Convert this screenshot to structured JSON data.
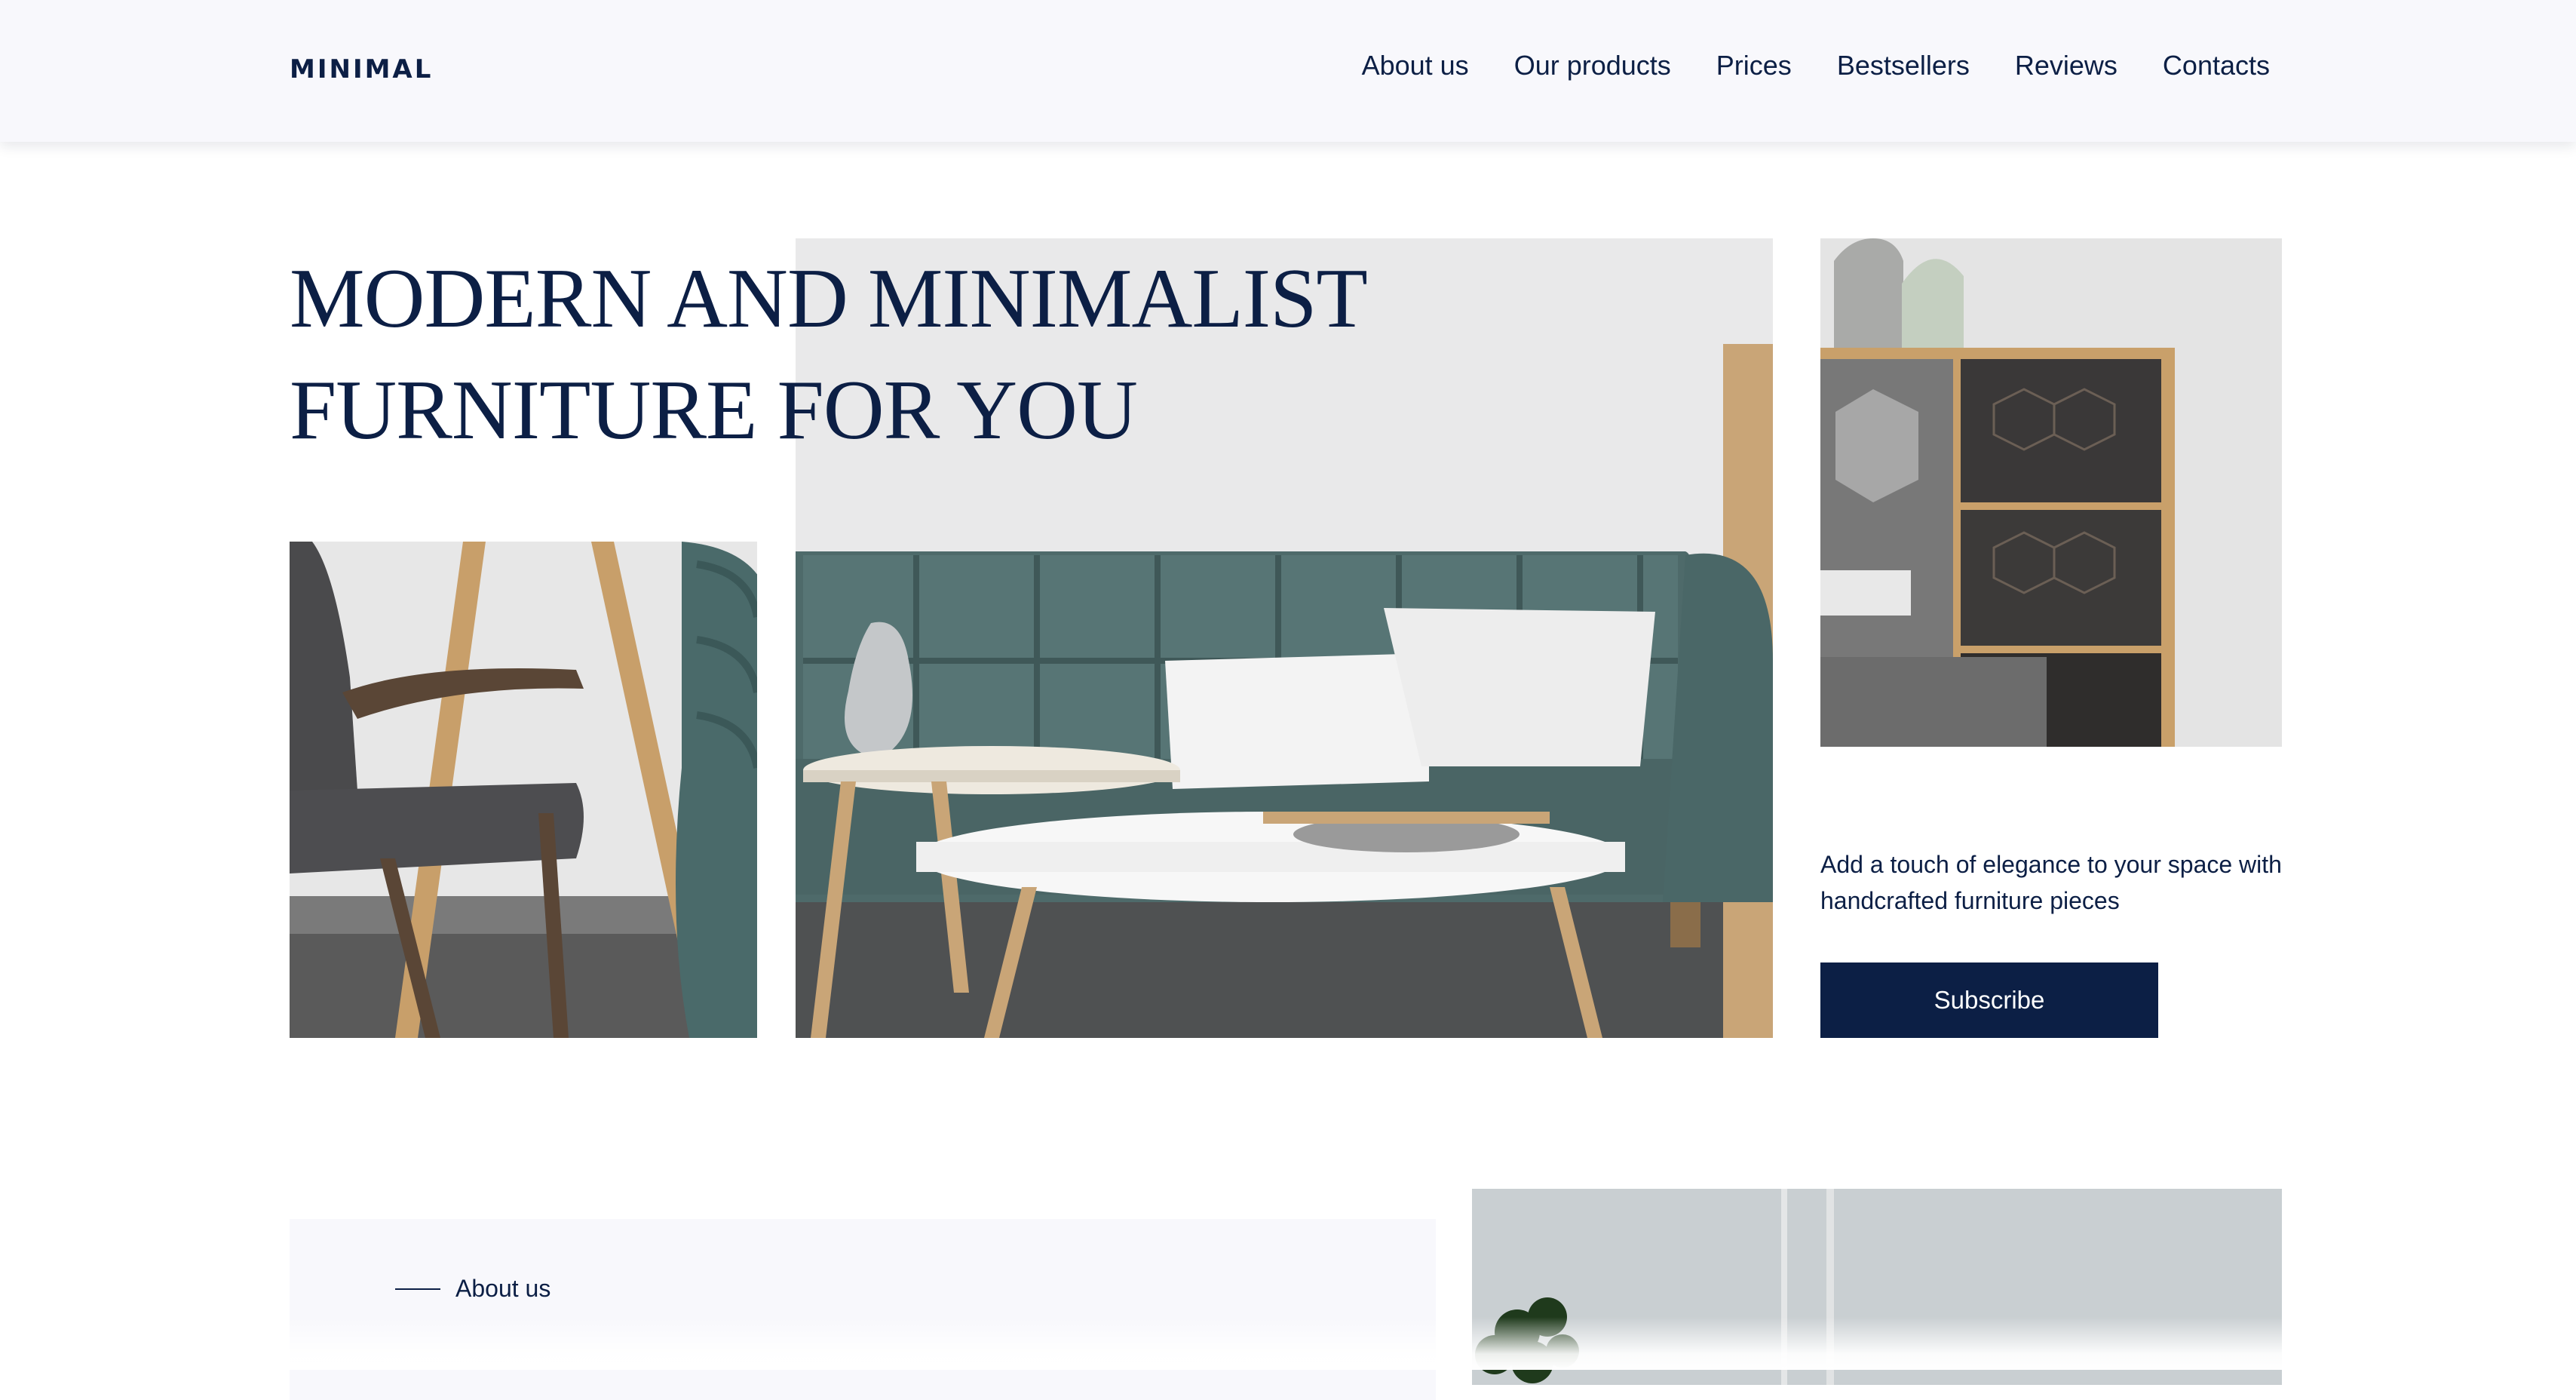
{
  "header": {
    "logo": "MINIMAL",
    "nav": [
      "About us",
      "Our products",
      "Prices",
      "Bestsellers",
      "Reviews",
      "Contacts"
    ]
  },
  "hero": {
    "title_line1": "MODERN AND MINIMALIST",
    "title_line2": "FURNITURE FOR YOU",
    "tagline": "Add a touch of elegance to your space with handcrafted furniture pieces",
    "subscribe_label": "Subscribe",
    "images": [
      "armchair-photo",
      "sofa-photo",
      "shelf-photo"
    ]
  },
  "about": {
    "label": "About us",
    "image": "room-plant-photo"
  },
  "colors": {
    "navy": "#0c1f45",
    "header_bg": "#f8f8fc",
    "panel_bg": "#f8f8fc"
  }
}
